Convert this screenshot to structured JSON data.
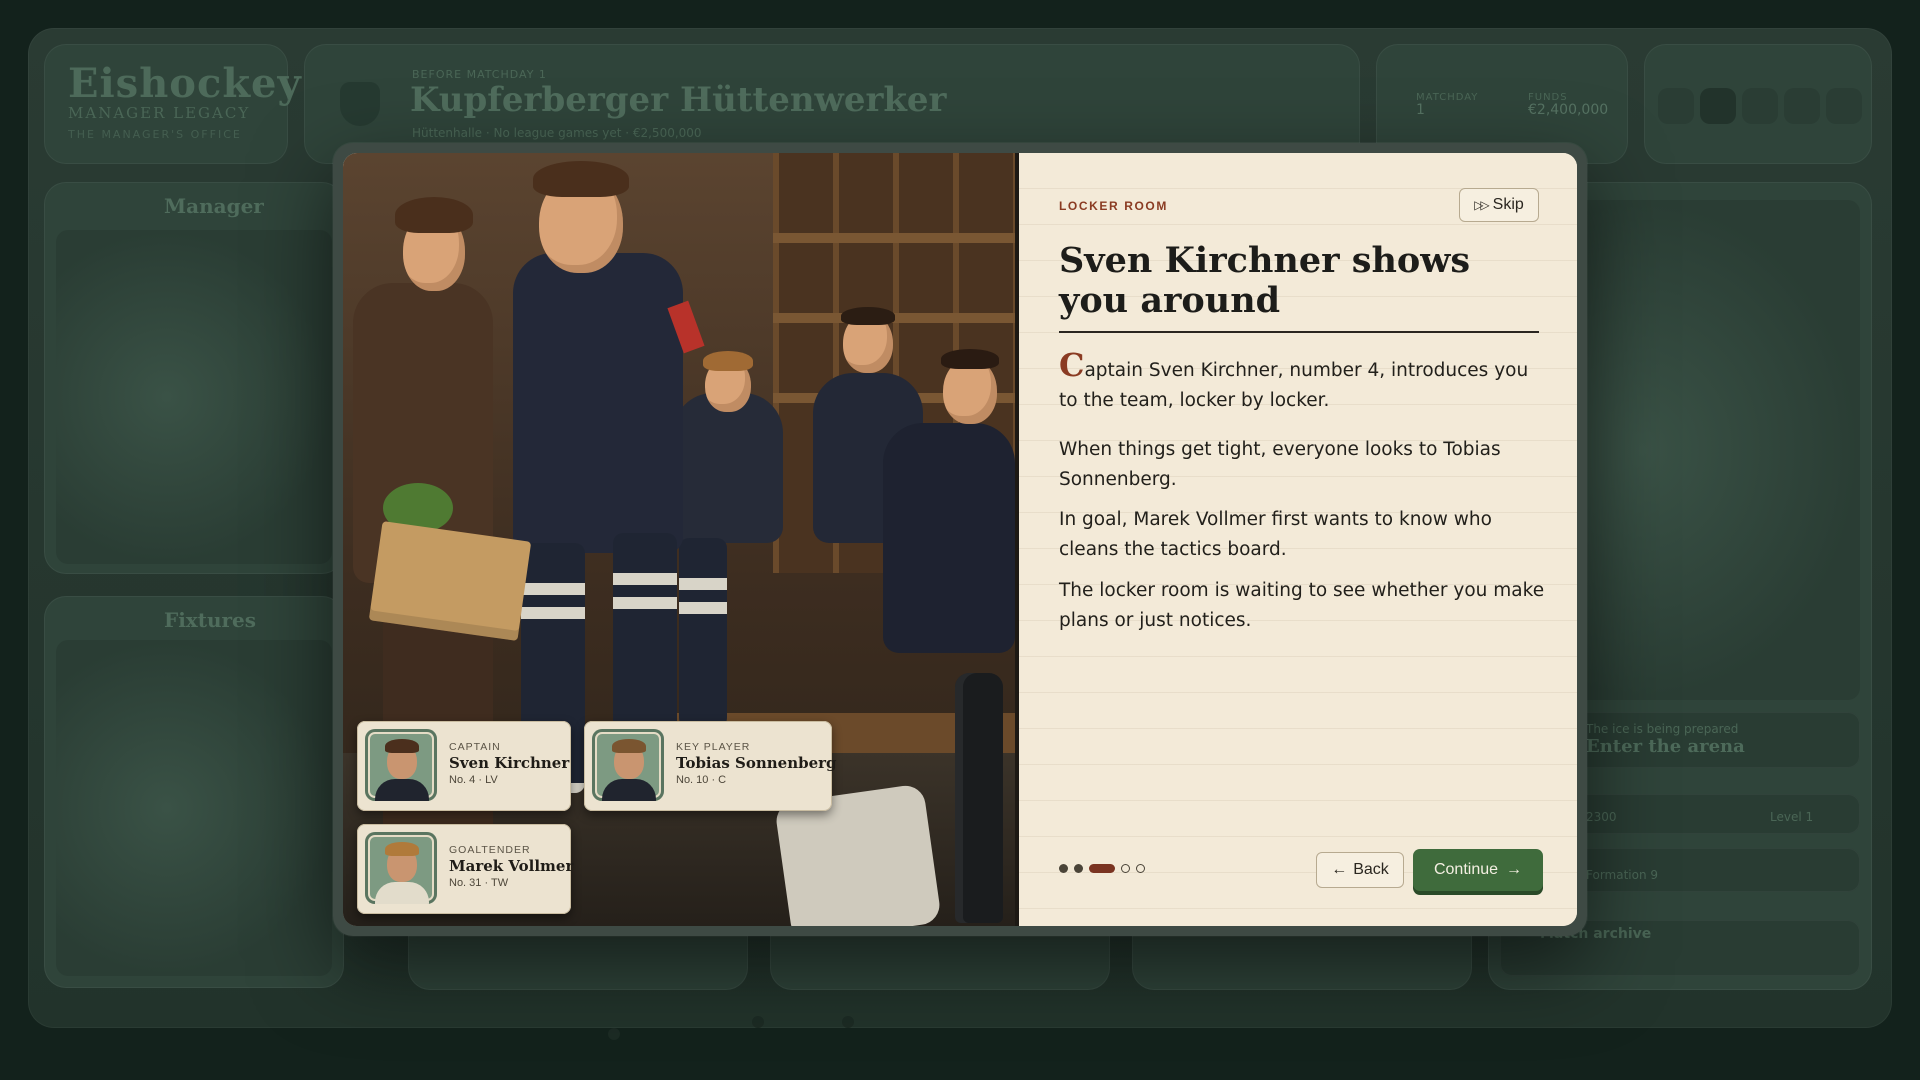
{
  "background": {
    "brand_title": "Eishockey",
    "brand_subtitle": "MANAGER LEGACY",
    "brand_tagline": "THE MANAGER'S OFFICE",
    "overline": "BEFORE MATCHDAY 1",
    "team_name": "Kupferberger Hüttenwerker",
    "team_meta": "Hüttenhalle · No league games yet · €2,500,000",
    "stats": [
      {
        "label": "MATCHDAY",
        "value": "1"
      },
      {
        "label": "FUNDS",
        "value": "€2,400,000"
      }
    ],
    "cards": {
      "manager_title": "Manager",
      "fixtures_title": "Fixtures"
    },
    "side_rows": {
      "arena_hint": "The ice is being prepared",
      "arena_title": "Enter the arena",
      "row2_left": "2300",
      "row2_right": "Level 1",
      "row3": "Formation 9",
      "row4": "Match archive"
    }
  },
  "modal": {
    "eyebrow": "LOCKER ROOM",
    "skip_label": "Skip",
    "headline": "Sven Kirchner shows you around",
    "paragraphs": {
      "p1_dropcap": "C",
      "p1_rest": "aptain Sven Kirchner, number 4, introduces you to the team, locker by locker.",
      "p2": "When things get tight, everyone looks to Tobias Sonnenberg.",
      "p3": "In goal, Marek Vollmer first wants to know who cleans the tactics board.",
      "p4": "The locker room is waiting to see whether you make plans or just notices."
    },
    "progress": {
      "total": 5,
      "current": 3
    },
    "back_label": "Back",
    "continue_label": "Continue",
    "players": [
      {
        "role": "CAPTAIN",
        "name": "Sven Kirchner",
        "meta": "No. 4 · LV"
      },
      {
        "role": "KEY PLAYER",
        "name": "Tobias Sonnenberg",
        "meta": "No. 10 · C"
      },
      {
        "role": "GOALTENDER",
        "name": "Marek Vollmer",
        "meta": "No. 31 · TW"
      }
    ],
    "colors": {
      "accent": "#8a3b22",
      "primary_button": "#3f6b3c",
      "paper": "#f3ead8"
    }
  }
}
